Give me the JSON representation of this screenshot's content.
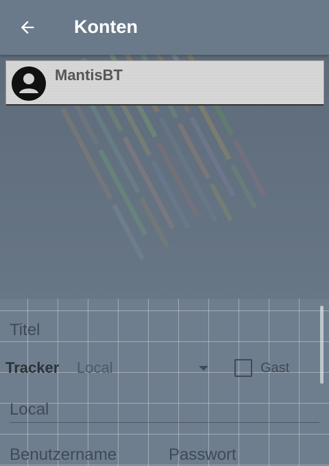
{
  "appbar": {
    "title": "Konten",
    "back_icon": "arrow-back-icon"
  },
  "account": {
    "name": "MantisBT",
    "avatar_icon": "account-circle-icon"
  },
  "form": {
    "title_placeholder": "Titel",
    "tracker_label": "Tracker",
    "tracker_value": "Local",
    "guest_label": "Gast",
    "guest_checked": false,
    "url_placeholder": "Local",
    "username_placeholder": "Benutzername",
    "password_placeholder": "Passwort"
  },
  "colors": {
    "appbar": "#6b7a8a",
    "background": "#6f7e8e",
    "card": "#d4d4d4",
    "title_text": "#ffffff"
  }
}
